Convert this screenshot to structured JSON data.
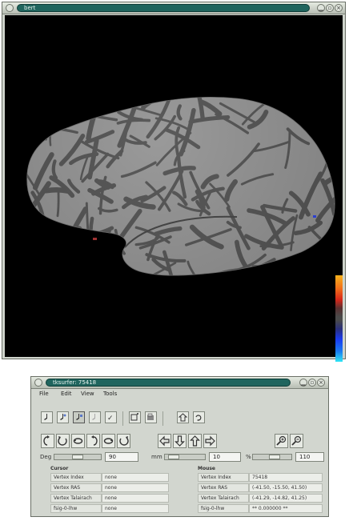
{
  "bert_window": {
    "title": "bert",
    "colorbar": {
      "colors": [
        "#f7b21c",
        "#f2701a",
        "#d8281a",
        "#4a4a4a",
        "#2a2f7a",
        "#1a3bf0",
        "#2ee6f4"
      ]
    }
  },
  "tksurfer_window": {
    "title": "tksurfer: 75418",
    "menu": [
      "File",
      "Edit",
      "View",
      "Tools"
    ],
    "sliders": {
      "deg": {
        "label": "Deg",
        "value": "90"
      },
      "mm": {
        "label": "mm",
        "value": "10"
      },
      "percent": {
        "label": "%",
        "value": "110"
      }
    },
    "cursor": {
      "title": "Cursor",
      "rows": [
        {
          "label": "Vertex Index",
          "value": "none"
        },
        {
          "label": "Vertex RAS",
          "value": "none"
        },
        {
          "label": "Vertex Talairach",
          "value": "none"
        },
        {
          "label": "fsig-0-lhw",
          "value": "none"
        }
      ]
    },
    "mouse": {
      "title": "Mouse",
      "rows": [
        {
          "label": "Vertex Index",
          "value": "75418"
        },
        {
          "label": "Vertex RAS",
          "value": "(-41.50, -15.50, 41.50)"
        },
        {
          "label": "Vertex Talairach",
          "value": "(-41.29, -14.82, 41.25)"
        },
        {
          "label": "fsig-0-lhw",
          "value": "** 0.000000 **"
        }
      ]
    }
  },
  "colors": {
    "title_pill": "#20655e",
    "window_bg": "#d2d6cf",
    "brain_light": "#9a9a9a",
    "brain_dark": "#5a5a5a"
  }
}
